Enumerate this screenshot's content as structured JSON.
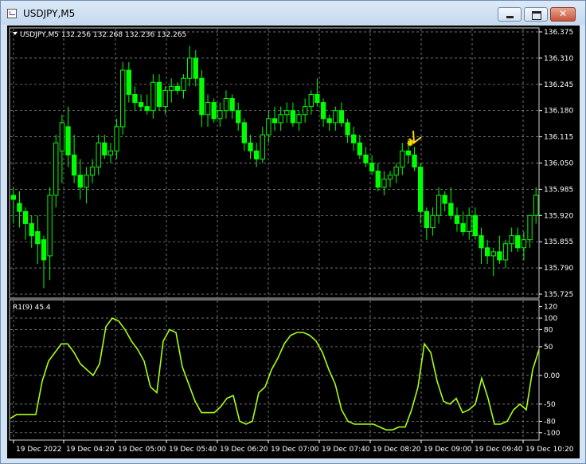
{
  "window": {
    "title": "USDJPY,M5"
  },
  "price_chart": {
    "header_text": "USDJPY,M5  132.256 132.268 132.236 132.265",
    "price_labels": [
      "136.375",
      "136.310",
      "136.245",
      "136.180",
      "136.115",
      "136.050",
      "135.985",
      "135.920",
      "135.855",
      "135.790",
      "135.725"
    ],
    "colors": {
      "background": "#000000",
      "candle": "#00ff00",
      "grid": "#9a9a9a",
      "marker": "#ffd700"
    }
  },
  "indicator": {
    "header_text": "R1(9) 45.4",
    "scale_labels": [
      "120",
      "100",
      "80",
      "50",
      "0.00",
      "-50",
      "-80",
      "-100"
    ],
    "color": "#a8ff10"
  },
  "time_axis": {
    "labels": [
      "19 Dec 2022",
      "19 Dec 04:20",
      "19 Dec 05:00",
      "19 Dec 05:40",
      "19 Dec 06:20",
      "19 Dec 07:00",
      "19 Dec 07:40",
      "19 Dec 08:20",
      "19 Dec 09:00",
      "19 Dec 09:40",
      "19 Dec 10:20"
    ]
  },
  "chart_data": [
    {
      "type": "candlestick",
      "title": "USDJPY,M5",
      "ylim": [
        135.725,
        136.375
      ],
      "grid": true,
      "candles": [
        [
          135.97,
          135.99,
          135.9,
          135.96
        ],
        [
          135.95,
          135.98,
          135.89,
          135.93
        ],
        [
          135.93,
          135.94,
          135.86,
          135.9
        ],
        [
          135.9,
          135.92,
          135.84,
          135.87
        ],
        [
          135.88,
          135.92,
          135.8,
          135.85
        ],
        [
          135.86,
          135.87,
          135.74,
          135.81
        ],
        [
          135.82,
          135.99,
          135.76,
          135.97
        ],
        [
          135.97,
          136.12,
          135.94,
          136.1
        ],
        [
          136.08,
          136.17,
          136.0,
          136.15
        ],
        [
          136.14,
          136.19,
          136.04,
          136.07
        ],
        [
          136.07,
          136.12,
          136.0,
          136.02
        ],
        [
          136.02,
          136.06,
          135.96,
          135.99
        ],
        [
          135.99,
          136.04,
          135.95,
          136.02
        ],
        [
          136.02,
          136.06,
          136.0,
          136.04
        ],
        [
          136.04,
          136.12,
          136.02,
          136.1
        ],
        [
          136.1,
          136.12,
          136.06,
          136.07
        ],
        [
          136.07,
          136.1,
          136.05,
          136.08
        ],
        [
          136.08,
          136.16,
          136.06,
          136.14
        ],
        [
          136.14,
          136.3,
          136.12,
          136.28
        ],
        [
          136.28,
          136.3,
          136.2,
          136.22
        ],
        [
          136.22,
          136.24,
          136.18,
          136.2
        ],
        [
          136.2,
          136.22,
          136.18,
          136.19
        ],
        [
          136.19,
          136.22,
          136.17,
          136.18
        ],
        [
          136.18,
          136.27,
          136.16,
          136.25
        ],
        [
          136.25,
          136.27,
          136.18,
          136.19
        ],
        [
          136.19,
          136.24,
          136.17,
          136.23
        ],
        [
          136.23,
          136.26,
          136.2,
          136.24
        ],
        [
          136.24,
          136.25,
          136.22,
          136.23
        ],
        [
          136.23,
          136.27,
          136.21,
          136.26
        ],
        [
          136.26,
          136.34,
          136.24,
          136.31
        ],
        [
          136.31,
          136.33,
          136.24,
          136.26
        ],
        [
          136.26,
          136.28,
          136.14,
          136.17
        ],
        [
          136.17,
          136.22,
          136.14,
          136.2
        ],
        [
          136.2,
          136.21,
          136.15,
          136.16
        ],
        [
          136.16,
          136.2,
          136.14,
          136.18
        ],
        [
          136.18,
          136.23,
          136.16,
          136.21
        ],
        [
          136.21,
          136.22,
          136.16,
          136.18
        ],
        [
          136.18,
          136.2,
          136.13,
          136.15
        ],
        [
          136.15,
          136.16,
          136.08,
          136.1
        ],
        [
          136.1,
          136.12,
          136.06,
          136.08
        ],
        [
          136.08,
          136.1,
          136.04,
          136.06
        ],
        [
          136.06,
          136.14,
          136.05,
          136.12
        ],
        [
          136.12,
          136.18,
          136.1,
          136.16
        ],
        [
          136.16,
          136.19,
          136.13,
          136.15
        ],
        [
          136.15,
          136.19,
          136.13,
          136.17
        ],
        [
          136.17,
          136.2,
          136.15,
          136.18
        ],
        [
          136.18,
          136.2,
          136.14,
          136.15
        ],
        [
          136.15,
          136.18,
          136.13,
          136.17
        ],
        [
          136.17,
          136.21,
          136.15,
          136.19
        ],
        [
          136.19,
          136.23,
          136.17,
          136.22
        ],
        [
          136.22,
          136.26,
          136.19,
          136.2
        ],
        [
          136.2,
          136.21,
          136.14,
          136.16
        ],
        [
          136.16,
          136.17,
          136.13,
          136.15
        ],
        [
          136.15,
          136.19,
          136.13,
          136.18
        ],
        [
          136.18,
          136.2,
          136.14,
          136.15
        ],
        [
          136.15,
          136.16,
          136.1,
          136.12
        ],
        [
          136.12,
          136.14,
          136.08,
          136.1
        ],
        [
          136.1,
          136.12,
          136.06,
          136.07
        ],
        [
          136.07,
          136.09,
          136.04,
          136.05
        ],
        [
          136.05,
          136.07,
          136.02,
          136.03
        ],
        [
          136.03,
          136.05,
          135.98,
          135.99
        ],
        [
          135.99,
          136.03,
          135.97,
          136.01
        ],
        [
          136.01,
          136.03,
          135.99,
          136.02
        ],
        [
          136.02,
          136.05,
          136.0,
          136.04
        ],
        [
          136.04,
          136.1,
          136.02,
          136.08
        ],
        [
          136.08,
          136.11,
          136.05,
          136.07
        ],
        [
          136.07,
          136.09,
          136.03,
          136.04
        ],
        [
          136.04,
          136.05,
          135.9,
          135.93
        ],
        [
          135.93,
          135.94,
          135.86,
          135.89
        ],
        [
          135.89,
          135.94,
          135.87,
          135.92
        ],
        [
          135.92,
          135.99,
          135.9,
          135.97
        ],
        [
          135.97,
          135.98,
          135.93,
          135.95
        ],
        [
          135.95,
          135.99,
          135.91,
          135.92
        ],
        [
          135.92,
          135.94,
          135.88,
          135.9
        ],
        [
          135.9,
          135.93,
          135.87,
          135.88
        ],
        [
          135.88,
          135.94,
          135.86,
          135.92
        ],
        [
          135.92,
          135.94,
          135.86,
          135.87
        ],
        [
          135.87,
          135.89,
          135.8,
          135.84
        ],
        [
          135.84,
          135.86,
          135.8,
          135.82
        ],
        [
          135.82,
          135.84,
          135.77,
          135.83
        ],
        [
          135.83,
          135.87,
          135.8,
          135.81
        ],
        [
          135.81,
          135.86,
          135.79,
          135.85
        ],
        [
          135.85,
          135.89,
          135.83,
          135.87
        ],
        [
          135.87,
          135.89,
          135.83,
          135.84
        ],
        [
          135.84,
          135.88,
          135.81,
          135.86
        ],
        [
          135.86,
          135.92,
          135.84,
          135.92
        ],
        [
          135.92,
          135.99,
          135.9,
          135.97
        ]
      ]
    },
    {
      "type": "line",
      "title": "R1(9) 45.4",
      "ylim": [
        -110,
        125
      ],
      "series": [
        {
          "values": [
            -75,
            -68,
            -68,
            -68,
            -68,
            -10,
            25,
            40,
            55,
            55,
            40,
            20,
            10,
            0,
            20,
            85,
            100,
            95,
            80,
            60,
            45,
            25,
            -20,
            -30,
            60,
            80,
            75,
            15,
            -15,
            -45,
            -65,
            -65,
            -65,
            -55,
            -40,
            -35,
            -80,
            -85,
            -80,
            -30,
            -20,
            10,
            30,
            55,
            70,
            75,
            75,
            70,
            60,
            40,
            10,
            -15,
            -60,
            -80,
            -85,
            -85,
            -85,
            -85,
            -90,
            -95,
            -95,
            -90,
            -90,
            -60,
            -20,
            55,
            40,
            -10,
            -45,
            -50,
            -40,
            -65,
            -60,
            -50,
            -5,
            -40,
            -85,
            -85,
            -80,
            -60,
            -50,
            -60,
            10,
            45
          ]
        }
      ]
    }
  ]
}
